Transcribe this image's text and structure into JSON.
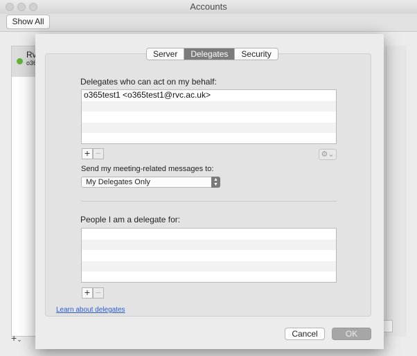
{
  "window": {
    "title": "Accounts",
    "show_all_label": "Show All",
    "account_name": "Rv",
    "account_sub": "o36",
    "add_label": "+",
    "add_menu": "⌄"
  },
  "tabs": [
    {
      "label": "Server",
      "active": false
    },
    {
      "label": "Delegates",
      "active": true
    },
    {
      "label": "Security",
      "active": false
    }
  ],
  "delegates": {
    "heading": "Delegates who can act on my behalf:",
    "rows": [
      "o365test1 <o365test1@rvc.ac.uk>",
      "",
      "",
      "",
      ""
    ],
    "add_label": "+",
    "remove_label": "−",
    "gear_label": "⚙⌄",
    "send_label": "Send my meeting-related messages to:",
    "send_value": "My Delegates Only"
  },
  "delegate_for": {
    "heading": "People I am a delegate for:",
    "rows": [
      "",
      "",
      "",
      "",
      ""
    ],
    "add_label": "+",
    "remove_label": "−"
  },
  "learn_link": "Learn about delegates",
  "buttons": {
    "cancel": "Cancel",
    "ok": "OK"
  }
}
